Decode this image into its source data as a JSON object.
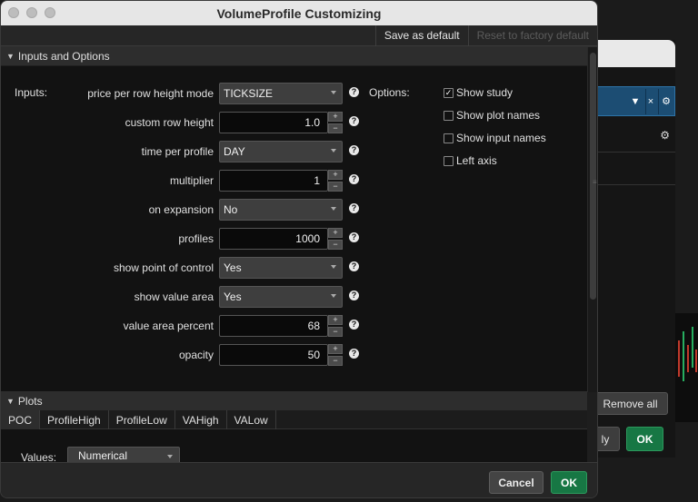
{
  "window": {
    "title": "VolumeProfile Customizing"
  },
  "toolbar": {
    "save_default": "Save as default",
    "reset_default": "Reset to factory default"
  },
  "inputs_section": {
    "header": "Inputs and Options",
    "inputs_label": "Inputs:",
    "options_label": "Options:",
    "rows": [
      {
        "name": "price per row height mode",
        "type": "dropdown",
        "value": "TICKSIZE"
      },
      {
        "name": "custom row height",
        "type": "number",
        "value": "1.0"
      },
      {
        "name": "time per profile",
        "type": "dropdown",
        "value": "DAY"
      },
      {
        "name": "multiplier",
        "type": "number",
        "value": "1"
      },
      {
        "name": "on expansion",
        "type": "dropdown",
        "value": "No"
      },
      {
        "name": "profiles",
        "type": "number",
        "value": "1000"
      },
      {
        "name": "show point of control",
        "type": "dropdown",
        "value": "Yes"
      },
      {
        "name": "show value area",
        "type": "dropdown",
        "value": "Yes"
      },
      {
        "name": "value area percent",
        "type": "number",
        "value": "68"
      },
      {
        "name": "opacity",
        "type": "number",
        "value": "50"
      }
    ],
    "options": [
      {
        "label": "Show study",
        "checked": true
      },
      {
        "label": "Show plot names",
        "checked": false
      },
      {
        "label": "Show input names",
        "checked": false
      },
      {
        "label": "Left axis",
        "checked": false
      }
    ],
    "help_glyph": "?",
    "check_glyph": "✓",
    "stepper_up": "+",
    "stepper_down": "−"
  },
  "plots_section": {
    "header": "Plots",
    "tabs": [
      "POC",
      "ProfileHigh",
      "ProfileLow",
      "VAHigh",
      "VALow"
    ],
    "active_tab": "POC",
    "values_label": "Values:",
    "values_value": "Numerical"
  },
  "footer": {
    "cancel": "Cancel",
    "ok": "OK"
  },
  "background_window": {
    "remove_all": "Remove all",
    "apply_partial": "ly",
    "ok": "OK",
    "row_icons": [
      "▼",
      "×",
      "⚙"
    ],
    "gear": "⚙"
  },
  "colors": {
    "ok_green": "#177744",
    "selection_blue": "#1c4d73",
    "panel_dark": "#121212",
    "titlebar": "#e6e6e6"
  }
}
